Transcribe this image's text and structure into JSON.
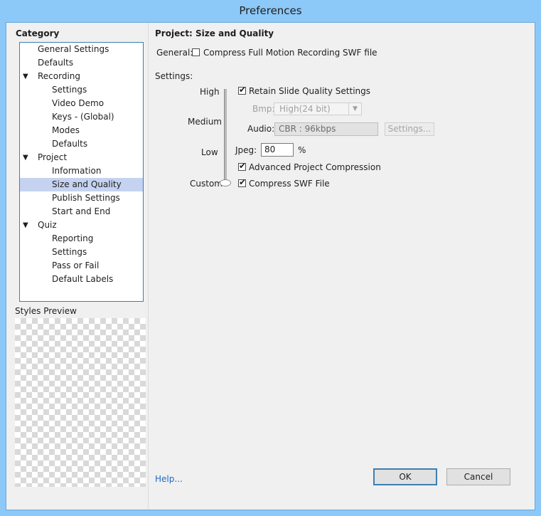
{
  "window": {
    "title": "Preferences"
  },
  "sidebar": {
    "category_title": "Category",
    "items": [
      {
        "label": "General Settings",
        "indent": 0,
        "expander": ""
      },
      {
        "label": "Defaults",
        "indent": 0,
        "expander": ""
      },
      {
        "label": "Recording",
        "indent": 0,
        "expander": "▼"
      },
      {
        "label": "Settings",
        "indent": 1,
        "expander": ""
      },
      {
        "label": "Video Demo",
        "indent": 1,
        "expander": ""
      },
      {
        "label": "Keys - (Global)",
        "indent": 1,
        "expander": ""
      },
      {
        "label": "Modes",
        "indent": 1,
        "expander": ""
      },
      {
        "label": "Defaults",
        "indent": 1,
        "expander": ""
      },
      {
        "label": "Project",
        "indent": 0,
        "expander": "▼"
      },
      {
        "label": "Information",
        "indent": 1,
        "expander": ""
      },
      {
        "label": "Size and Quality",
        "indent": 1,
        "expander": "",
        "selected": true
      },
      {
        "label": "Publish Settings",
        "indent": 1,
        "expander": ""
      },
      {
        "label": "Start and End",
        "indent": 1,
        "expander": ""
      },
      {
        "label": "Quiz",
        "indent": 0,
        "expander": "▼"
      },
      {
        "label": "Reporting",
        "indent": 1,
        "expander": ""
      },
      {
        "label": "Settings",
        "indent": 1,
        "expander": ""
      },
      {
        "label": "Pass or Fail",
        "indent": 1,
        "expander": ""
      },
      {
        "label": "Default Labels",
        "indent": 1,
        "expander": ""
      }
    ],
    "styles_preview_label": "Styles Preview"
  },
  "main": {
    "section_title": "Project: Size and Quality",
    "general_label": "General:",
    "compress_fmr_label": "Compress Full Motion Recording SWF file",
    "compress_fmr_checked": false,
    "settings_label": "Settings:",
    "quality_levels": [
      "High",
      "Medium",
      "Low",
      "Custom"
    ],
    "quality_selected": "Custom",
    "retain_quality_label": "Retain Slide Quality Settings",
    "retain_quality_checked": true,
    "bmp_label": "Bmp:",
    "bmp_value": "High(24 bit)",
    "audio_label": "Audio:",
    "audio_value": "CBR : 96kbps",
    "audio_settings_button": "Settings...",
    "jpeg_label": "Jpeg:",
    "jpeg_value": "80",
    "jpeg_unit": "%",
    "advanced_compression_label": "Advanced Project Compression",
    "advanced_compression_checked": true,
    "compress_swf_label": "Compress SWF File",
    "compress_swf_checked": true,
    "check_glyph": "✔"
  },
  "footer": {
    "help_link": "Help...",
    "ok_button": "OK",
    "cancel_button": "Cancel"
  }
}
